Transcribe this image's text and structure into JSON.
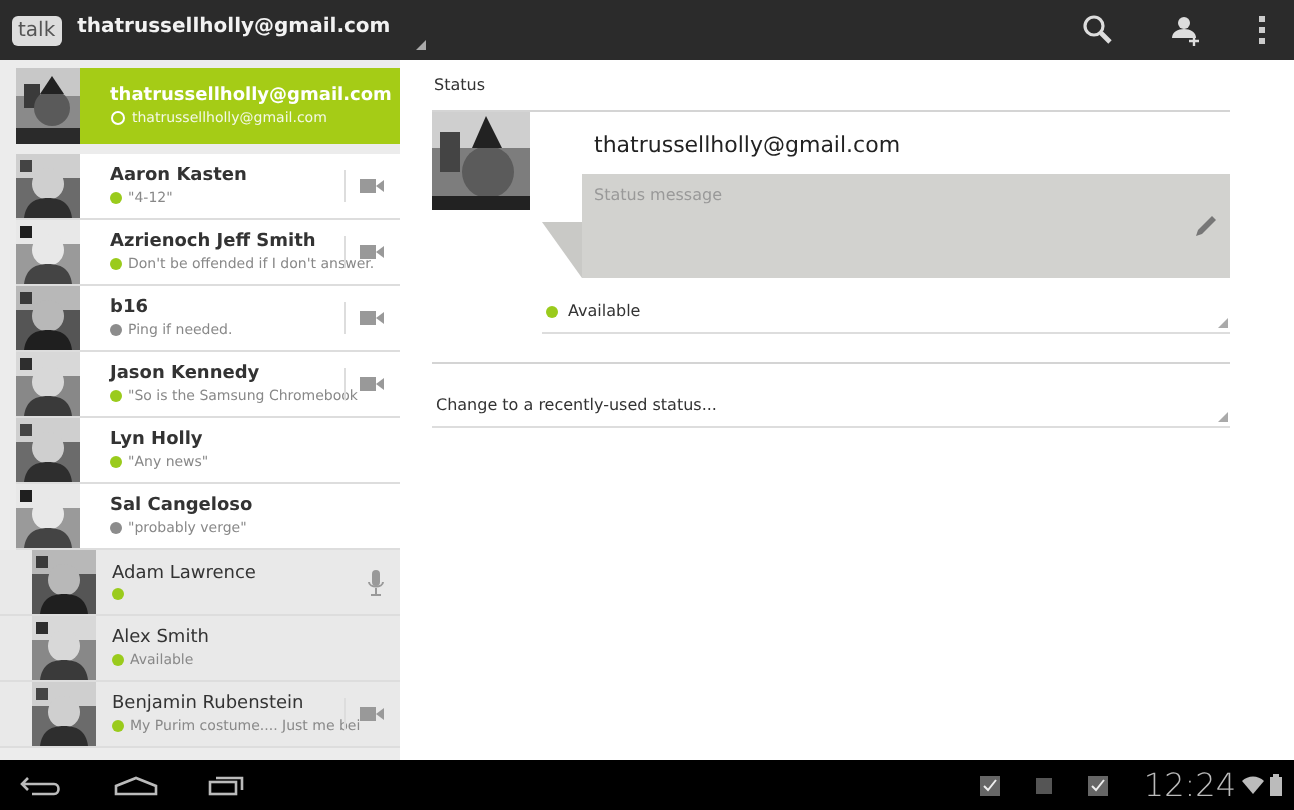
{
  "action_bar": {
    "logo": "talk",
    "account": "thatrussellholly@gmail.com"
  },
  "self": {
    "name": "thatrussellholly@gmail.com",
    "status": "thatrussellholly@gmail.com",
    "selected": true
  },
  "contacts": [
    {
      "name": "Aaron Kasten",
      "status": "\"4-12\"",
      "color": "#9acb1c",
      "kind": "video"
    },
    {
      "name": "Azrienoch Jeff Smith",
      "status": "Don't be offended if I don't answer.",
      "color": "#9acb1c",
      "kind": "video"
    },
    {
      "name": "b16",
      "status": "Ping if needed.",
      "color": "#8c8c8c",
      "kind": "video"
    },
    {
      "name": "Jason Kennedy",
      "status": "\"So is the Samsung Chromebook",
      "color": "#9acb1c",
      "kind": "video"
    },
    {
      "name": "Lyn Holly",
      "status": "\"Any news\"",
      "color": "#9acb1c",
      "kind": "plain"
    },
    {
      "name": "Sal Cangeloso",
      "status": "\"probably verge\"",
      "color": "#8c8c8c",
      "kind": "plain"
    }
  ],
  "other_contacts": [
    {
      "name": "Adam Lawrence",
      "color": "#9acb1c",
      "kind": "mic"
    },
    {
      "name": "Alex Smith",
      "status": "Available",
      "color": "#9acb1c",
      "kind": "plain"
    },
    {
      "name": "Benjamin Rubenstein",
      "status": "My Purim costume.... Just me bei",
      "color": "#9acb1c",
      "kind": "video"
    }
  ],
  "status_panel": {
    "heading": "Status",
    "email": "thatrussellholly@gmail.com",
    "message": {
      "placeholder": "Status message"
    },
    "presence": {
      "label": "Available",
      "color": "#9acb1c"
    },
    "recent": "Change to a recently-used status..."
  },
  "system_bar": {
    "time": "12:24"
  }
}
